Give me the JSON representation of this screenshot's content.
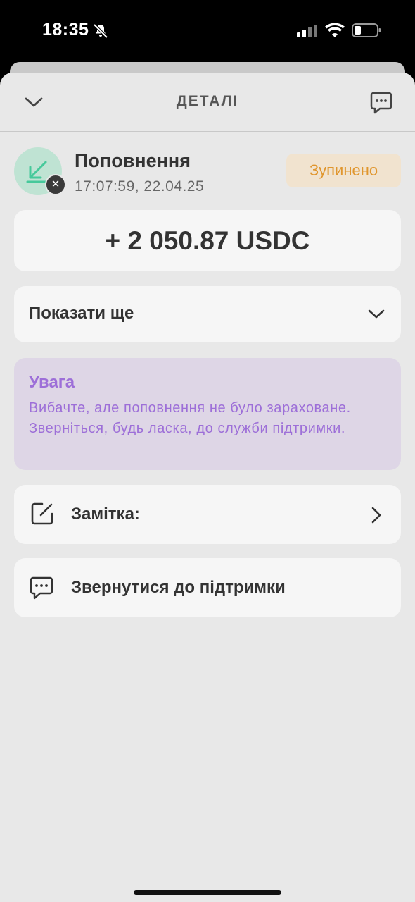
{
  "status_bar": {
    "time": "18:35",
    "icons": [
      "bell-off-icon",
      "signal-icon",
      "wifi-icon",
      "battery-icon"
    ]
  },
  "header": {
    "title": "ДЕТАЛІ",
    "back_icon": "chevron-down-icon",
    "chat_icon": "chat-icon"
  },
  "transaction": {
    "title": "Поповнення",
    "datetime": "17:07:59, 22.04.25",
    "status": "Зупинено",
    "status_color": "#e0962e",
    "icon": "arrow-down-left-icon",
    "badge_symbol": "✕"
  },
  "amount": {
    "text": "+ 2 050.87 USDC"
  },
  "more": {
    "label": "Показати ще"
  },
  "warning": {
    "title": "Увага",
    "message": "Вибачте, але поповнення не було зараховане. Зверніться, будь ласка, до служби підтримки.",
    "color": "#9d6fd8"
  },
  "note": {
    "label": "Замітка:"
  },
  "support": {
    "label": "Звернутися до підтримки"
  }
}
